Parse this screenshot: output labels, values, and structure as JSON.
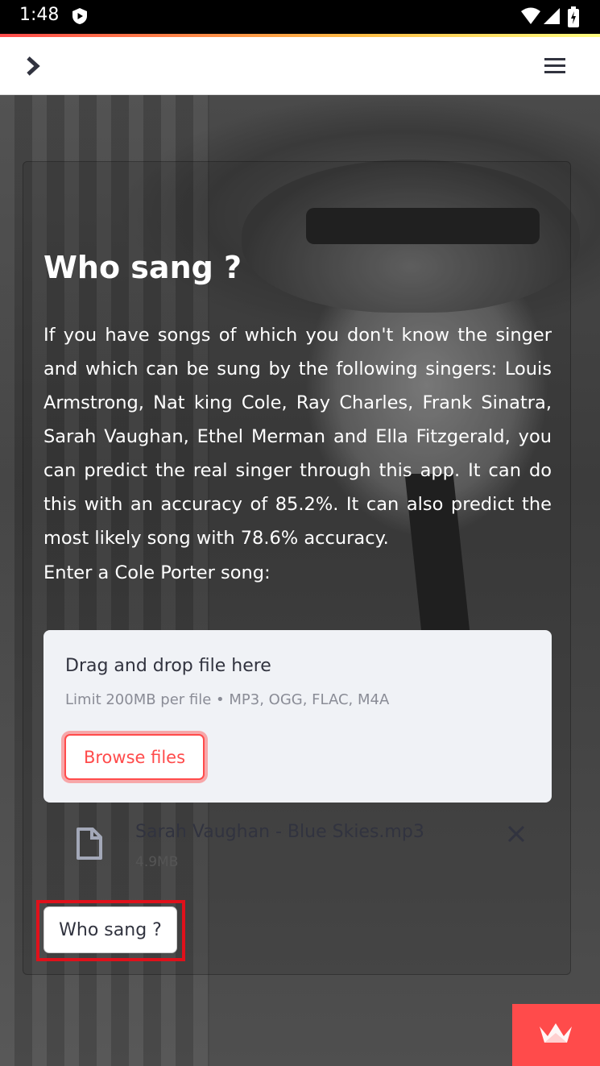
{
  "status_bar": {
    "time": "1:48"
  },
  "header": {
    "sidebar_toggle_icon": "chevron-right-icon",
    "menu_icon": "hamburger-menu-icon"
  },
  "main": {
    "title": "Who sang ?",
    "description": "If you have songs of which you don't know the singer and which can be sung by the following singers: Louis Armstrong, Nat king Cole, Ray Charles, Frank Sinatra, Sarah Vaughan, Ethel Merman and Ella Fitzgerald, you can predict the real singer through this app. It can do this with an accuracy of 85.2%. It can also predict the most likely song with 78.6% accuracy.",
    "prompt": "Enter a Cole Porter song:",
    "uploader": {
      "title": "Drag and drop file here",
      "limit": "Limit 200MB per file • MP3, OGG, FLAC, M4A",
      "browse_label": "Browse files"
    },
    "file": {
      "name": "Sarah Vaughan - Blue Skies.mp3",
      "size": "4.9MB"
    },
    "submit_label": "Who sang ?"
  },
  "colors": {
    "accent": "#ff4b4b",
    "highlight": "#e0111b"
  }
}
